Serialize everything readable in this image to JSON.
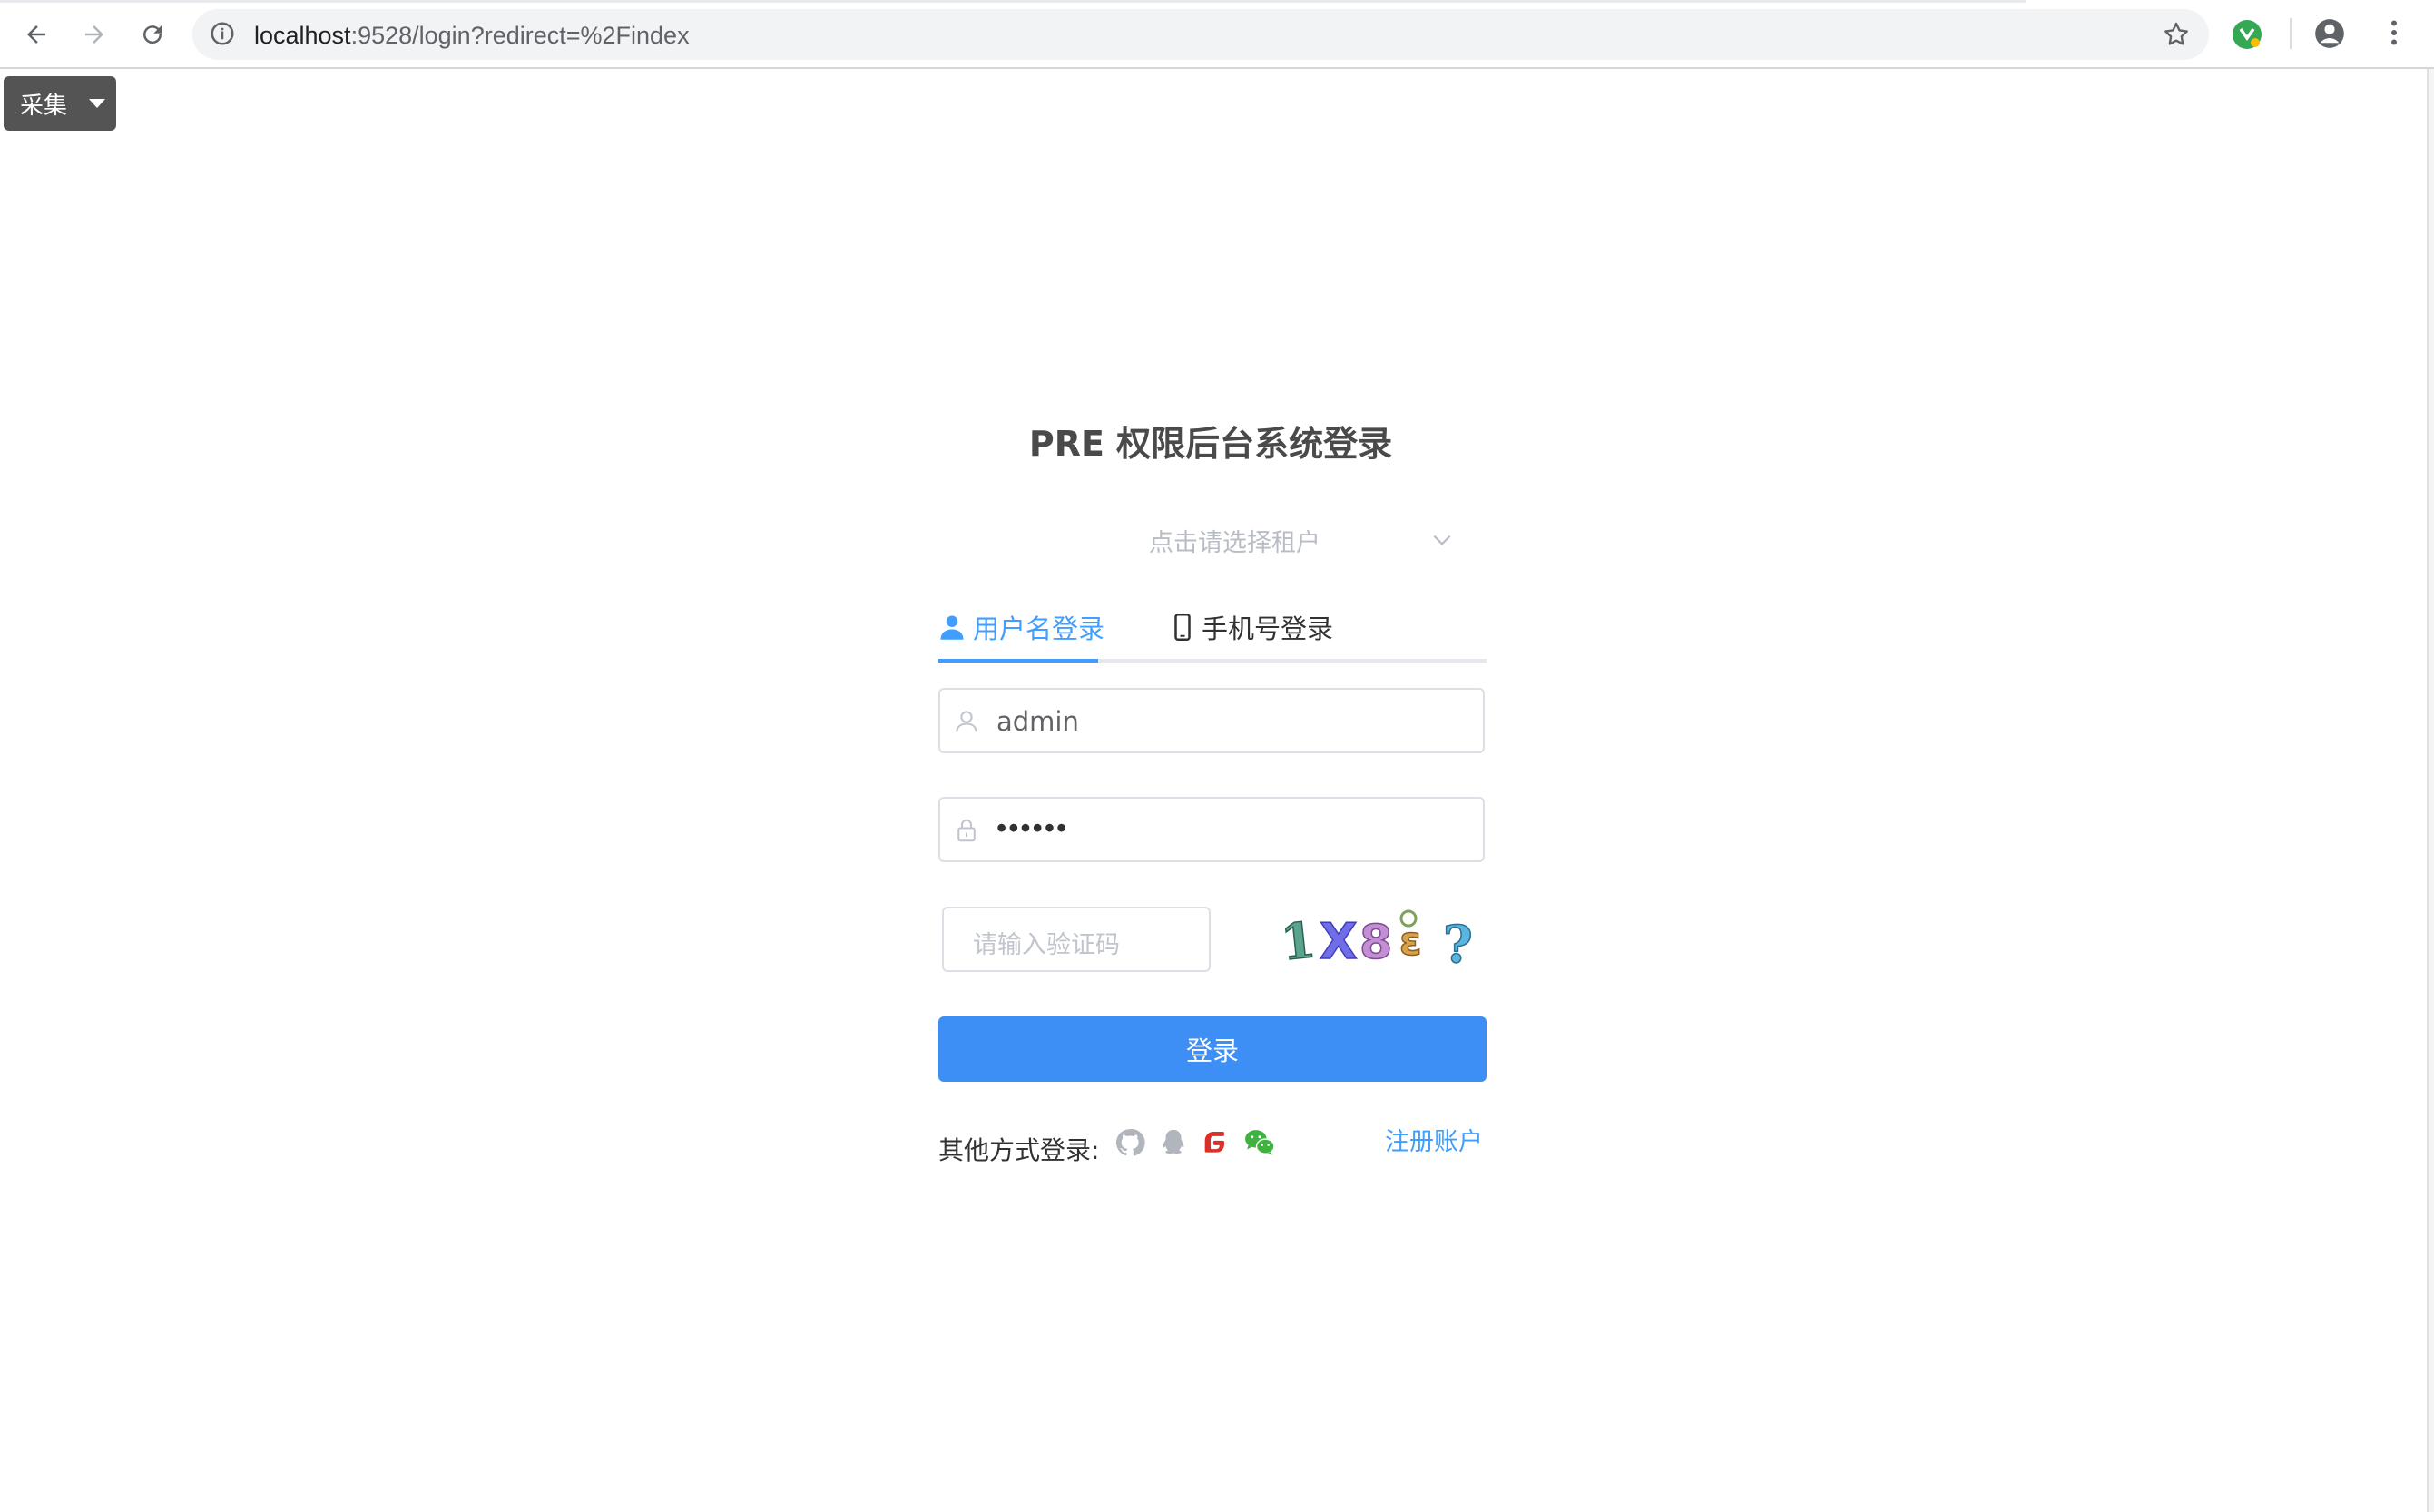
{
  "browser": {
    "url_host": "localhost",
    "url_rest": ":9528/login?redirect=%2Findex"
  },
  "toolbar": {
    "collect_label": "采集"
  },
  "login": {
    "title": "PRE 权限后台系统登录",
    "tenant_placeholder": "点击请选择租户",
    "tabs": [
      {
        "label": "用户名登录",
        "active": true,
        "icon": "user-icon"
      },
      {
        "label": "手机号登录",
        "active": false,
        "icon": "mobile-icon"
      }
    ],
    "username": {
      "value": "admin",
      "icon": "user-outline-icon"
    },
    "password": {
      "value": "••••••",
      "icon": "lock-icon"
    },
    "captcha": {
      "placeholder": "请输入验证码",
      "image_text": "1X8ε?"
    },
    "submit_label": "登录",
    "other_login_label": "其他方式登录:",
    "social_icons": [
      "github-icon",
      "qq-icon",
      "gitee-icon",
      "wechat-icon"
    ],
    "register_label": "注册账户"
  },
  "colors": {
    "primary": "#409eff",
    "button": "#3d8ff5",
    "title": "#4a4a4a"
  }
}
